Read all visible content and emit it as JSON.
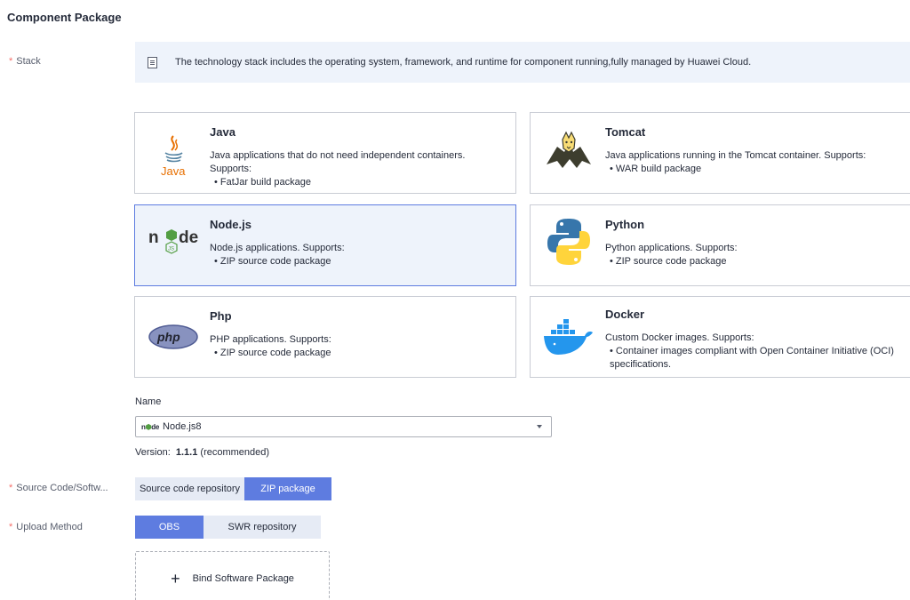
{
  "section_title": "Component Package",
  "stack": {
    "label": "Stack",
    "info": "The technology stack includes the operating system, framework, and runtime for component running,fully managed by Huawei Cloud.",
    "cards": [
      {
        "name": "Java",
        "desc": "Java applications that do not need independent containers.",
        "supports": "Supports:",
        "bullet": "•  FatJar build package",
        "icon": "java-logo-icon",
        "selected": false
      },
      {
        "name": "Tomcat",
        "desc": "Java applications running in the Tomcat container. Supports:",
        "supports": "",
        "bullet": "•  WAR build package",
        "icon": "tomcat-logo-icon",
        "selected": false
      },
      {
        "name": "Node.js",
        "desc": "Node.js applications. Supports:",
        "supports": "",
        "bullet": "•  ZIP source code package",
        "icon": "nodejs-logo-icon",
        "selected": true
      },
      {
        "name": "Python",
        "desc": "Python applications. Supports:",
        "supports": "",
        "bullet": "•  ZIP source code package",
        "icon": "python-logo-icon",
        "selected": false
      },
      {
        "name": "Php",
        "desc": "PHP applications. Supports:",
        "supports": "",
        "bullet": "•  ZIP source code package",
        "icon": "php-logo-icon",
        "selected": false
      },
      {
        "name": "Docker",
        "desc": "Custom Docker images. Supports:",
        "supports": "",
        "bullet": "•  Container images compliant with Open Container Initiative (OCI) specifications.",
        "icon": "docker-logo-icon",
        "selected": false
      }
    ]
  },
  "name_field": {
    "label": "Name",
    "value": "Node.js8"
  },
  "version": {
    "prefix": "Version:",
    "number": "1.1.1",
    "suffix": "(recommended)"
  },
  "source": {
    "label": "Source Code/Softw...",
    "options": [
      "Source code repository",
      "ZIP package"
    ],
    "selected": "ZIP package"
  },
  "upload": {
    "label": "Upload Method",
    "options": [
      "OBS",
      "SWR repository"
    ],
    "selected": "OBS"
  },
  "bind_button": "Bind Software Package",
  "colors": {
    "accent": "#5e7ce0",
    "selected_bg": "#eef3fb",
    "required": "#f66f6a"
  }
}
